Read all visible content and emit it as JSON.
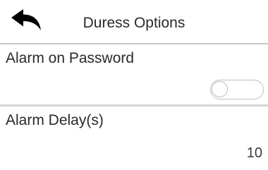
{
  "header": {
    "title": "Duress Options",
    "back_icon": "back-arrow-icon"
  },
  "options": {
    "alarm_on_password": {
      "label": "Alarm on Password",
      "enabled": false
    },
    "alarm_delay": {
      "label": "Alarm Delay(s)",
      "value": "10"
    }
  },
  "colors": {
    "background": "#ffffff",
    "text": "#2a2a2a",
    "divider": "#d6d6d6",
    "toggle_off_border": "#bdbdbd"
  }
}
